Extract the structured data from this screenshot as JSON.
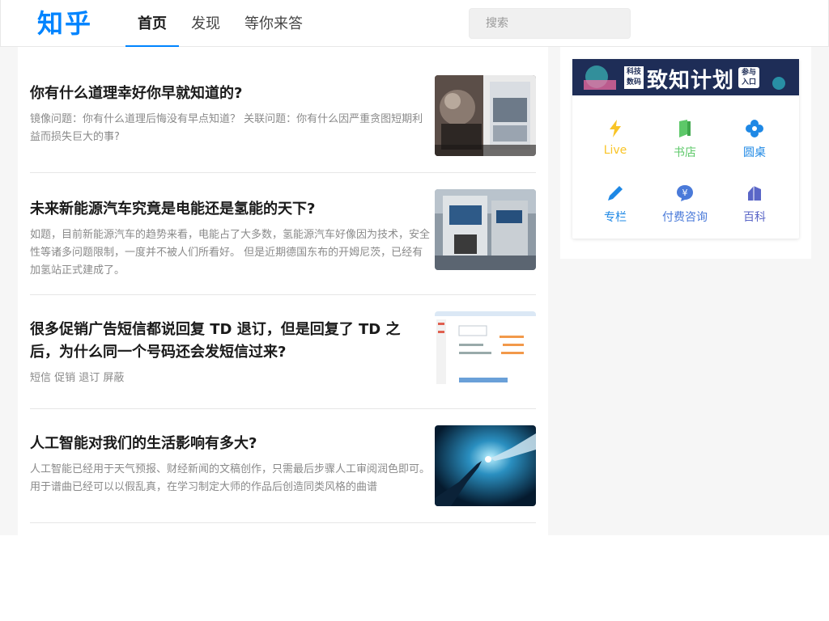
{
  "header": {
    "logo": "知乎",
    "nav": [
      "首页",
      "发现",
      "等你来答"
    ],
    "search_placeholder": "搜索"
  },
  "feed": [
    {
      "title": "你有什么道理幸好你早就知道的?",
      "excerpt": "镜像问题：你有什么道理后悔没有早点知道？ 关联问题：你有什么因严重贪图短期利益而损失巨大的事?"
    },
    {
      "title": "未来新能源汽车究竟是电能还是氢能的天下?",
      "excerpt": "如题，目前新能源汽车的趋势来看，电能占了大多数，氢能源汽车好像因为技术，安全性等诸多问题限制，一度并不被人们所看好。 但是近期德国东布的开姆尼茨，已经有加氢站正式建成了。"
    },
    {
      "title": "很多促销广告短信都说回复 TD 退订，但是回复了 TD 之后，为什么同一个号码还会发短信过来?",
      "excerpt": "短信 促销 退订 屏蔽"
    },
    {
      "title": "人工智能对我们的生活影响有多大?",
      "excerpt": "人工智能已经用于天气预报、财经新闻的文稿创作，只需最后步骤人工审阅润色即可。用于谱曲已经可以以假乱真，在学习制定大师的作品后创造同类风格的曲谱"
    }
  ],
  "sidebar": {
    "banner": {
      "tag": "科技数码",
      "title": "致知计划",
      "cta": "参与入口"
    },
    "tools": [
      {
        "label": "Live",
        "icon": "lightning-icon",
        "color": "#f9c426"
      },
      {
        "label": "书店",
        "icon": "book-icon",
        "color": "#5dc869"
      },
      {
        "label": "圆桌",
        "icon": "flower-icon",
        "color": "#1e88e5"
      },
      {
        "label": "专栏",
        "icon": "pencil-icon",
        "color": "#1e88e5"
      },
      {
        "label": "付费咨询",
        "icon": "yen-bubble-icon",
        "color": "#4a7ad9"
      },
      {
        "label": "百科",
        "icon": "encyclopedia-icon",
        "color": "#5a66c7"
      }
    ]
  }
}
